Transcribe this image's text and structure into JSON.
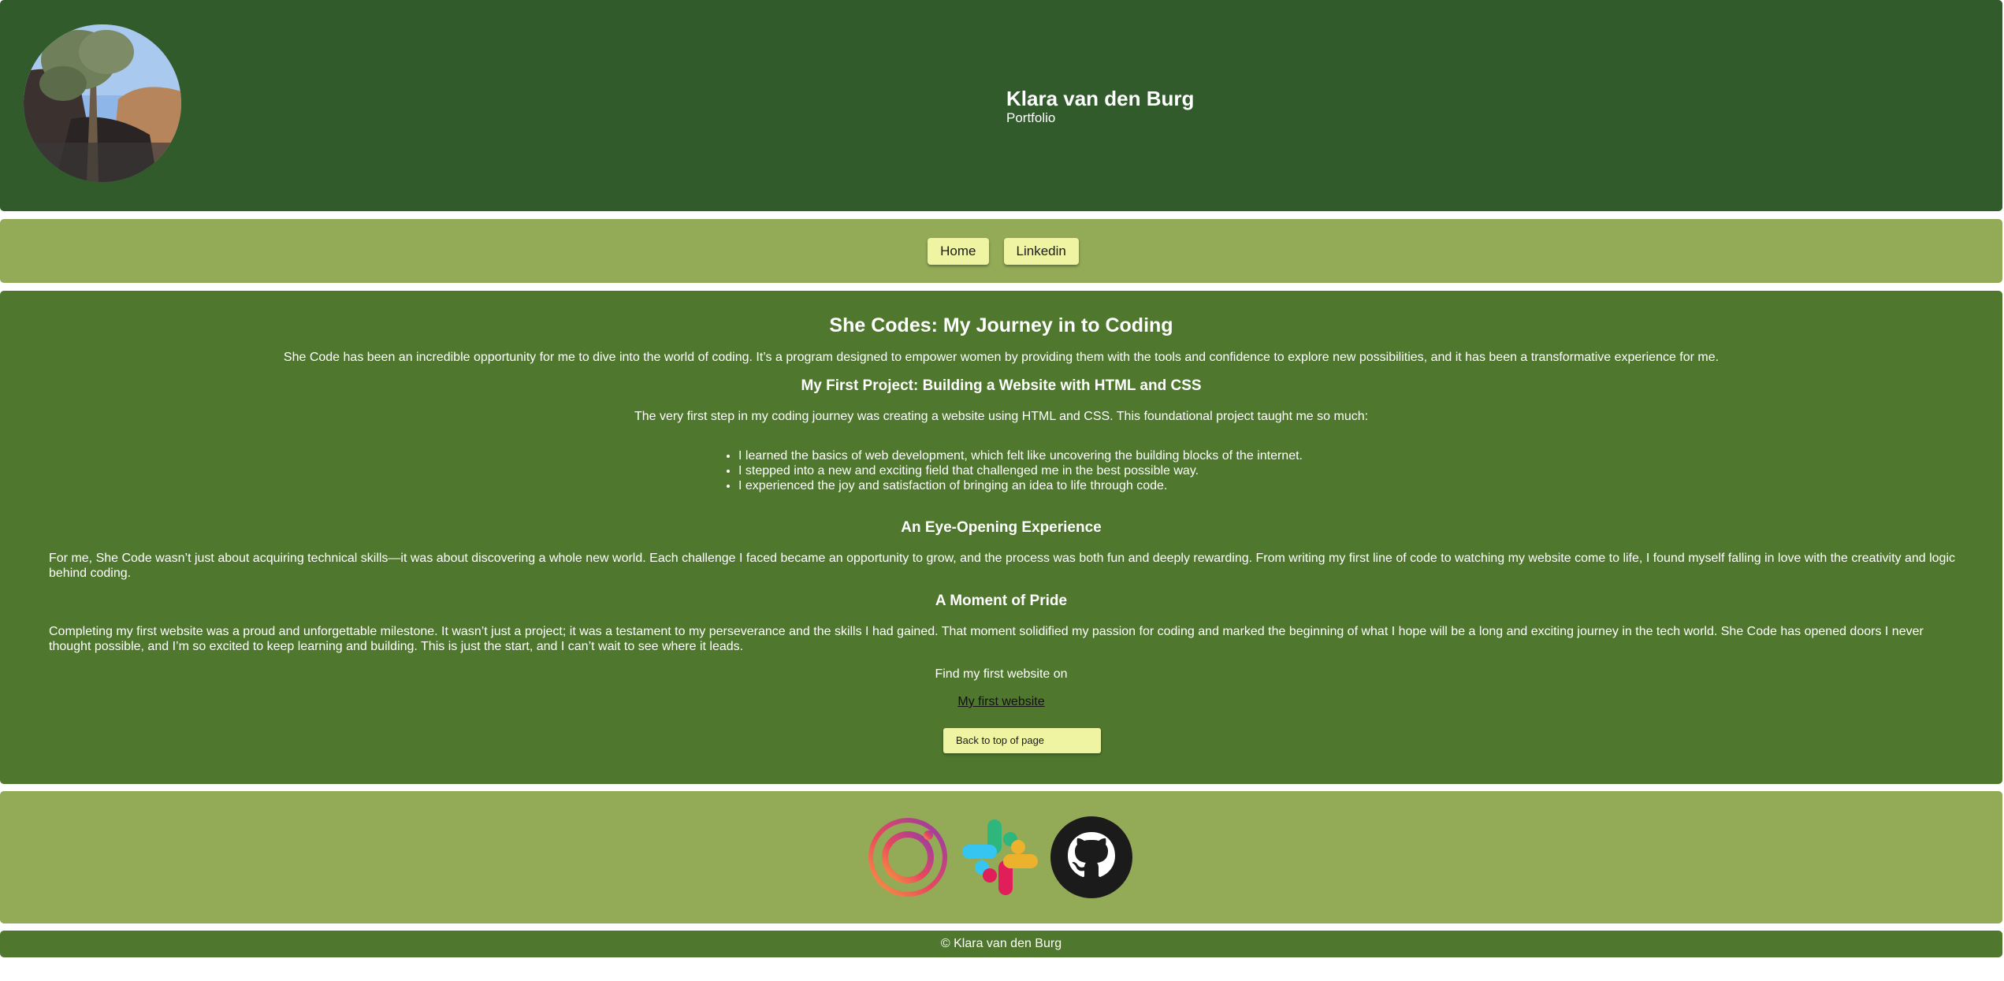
{
  "header": {
    "name": "Klara van den Burg",
    "subtitle": "Portfolio",
    "avatar_icon": "profile-photo-tree"
  },
  "nav": {
    "items": [
      {
        "label": "Home"
      },
      {
        "label": "Linkedin"
      }
    ]
  },
  "article": {
    "title": "She Codes: My Journey in to Coding",
    "intro": "She Code has been an incredible opportunity for me to dive into the world of coding. It’s a program designed to empower women by providing them with the tools and confidence to explore new possibilities, and it has been a transformative experience for me.",
    "section1_heading": "My First Project: Building a Website with HTML and CSS",
    "section1_text": "The very first step in my coding journey was creating a website using HTML and CSS. This foundational project taught me so much:",
    "section1_list": [
      "I learned the basics of web development, which felt like uncovering the building blocks of the internet.",
      "I stepped into a new and exciting field that challenged me in the best possible way.",
      "I experienced the joy and satisfaction of bringing an idea to life through code."
    ],
    "section2_heading": "An Eye-Opening Experience",
    "section2_text": "For me, She Code wasn’t just about acquiring technical skills—it was about discovering a whole new world. Each challenge I faced became an opportunity to grow, and the process was both fun and deeply rewarding. From writing my first line of code to watching my website come to life, I found myself falling in love with the creativity and logic behind coding.",
    "section3_heading": "A Moment of Pride",
    "section3_text": "Completing my first website was a proud and unforgettable milestone. It wasn’t just a project; it was a testament to my perseverance and the skills I had gained. That moment solidified my passion for coding and marked the beginning of what I hope will be a long and exciting journey in the tech world. She Code has opened doors I never thought possible, and I’m so excited to keep learning and building. This is just the start, and I can’t wait to see where it leads.",
    "find_text": "Find my first website on",
    "link_text": "My first website",
    "back_to_top": "Back to top of page"
  },
  "socials": [
    {
      "icon": "instagram-icon"
    },
    {
      "icon": "slack-icon"
    },
    {
      "icon": "github-icon"
    }
  ],
  "footer": {
    "copyright": "© Klara van den Burg"
  },
  "colors": {
    "header_bg": "#325b2c",
    "nav_bg": "#93aa57",
    "main_bg": "#4f772d",
    "button_bg": "#eef4a2"
  }
}
